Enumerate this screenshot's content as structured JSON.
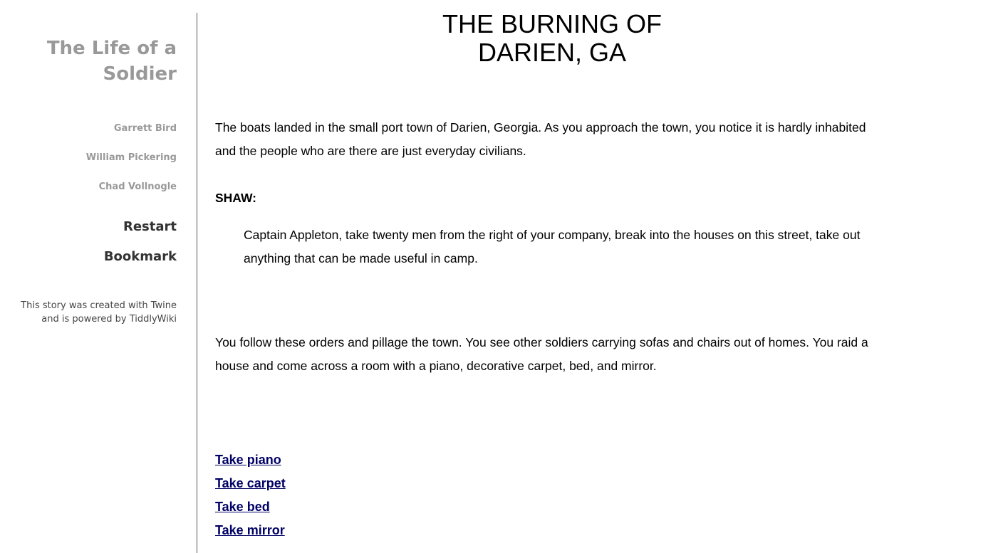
{
  "sidebar": {
    "story_title": "The Life of a Soldier",
    "authors": [
      "Garrett Bird",
      "William Pickering",
      "Chad Vollnogle"
    ],
    "menu": {
      "restart": "Restart",
      "bookmark": "Bookmark"
    },
    "credits": "This story was created with Twine and is powered by TiddlyWiki"
  },
  "passage": {
    "title": "THE BURNING OF DARIEN, GA",
    "paragraph1": "The boats landed in the small port town of Darien, Georgia. As you approach the town, you notice it is hardly inhabited and the people who are there are just everyday civilians.",
    "speaker": "SHAW:",
    "quote": "Captain Appleton, take twenty men from the right of your company, break into the houses on this street, take out anything that can be made useful in camp.",
    "paragraph2": "You follow these orders and pillage the town. You see other soldiers carrying sofas and chairs out of homes. You raid a house and come across a room with a piano, decorative carpet, bed, and mirror."
  },
  "choices": [
    "Take piano",
    "Take carpet",
    "Take bed",
    "Take mirror"
  ],
  "colors": {
    "sidebar_title": "#999999",
    "menu_link": "#333333",
    "choice_link": "#000066"
  }
}
